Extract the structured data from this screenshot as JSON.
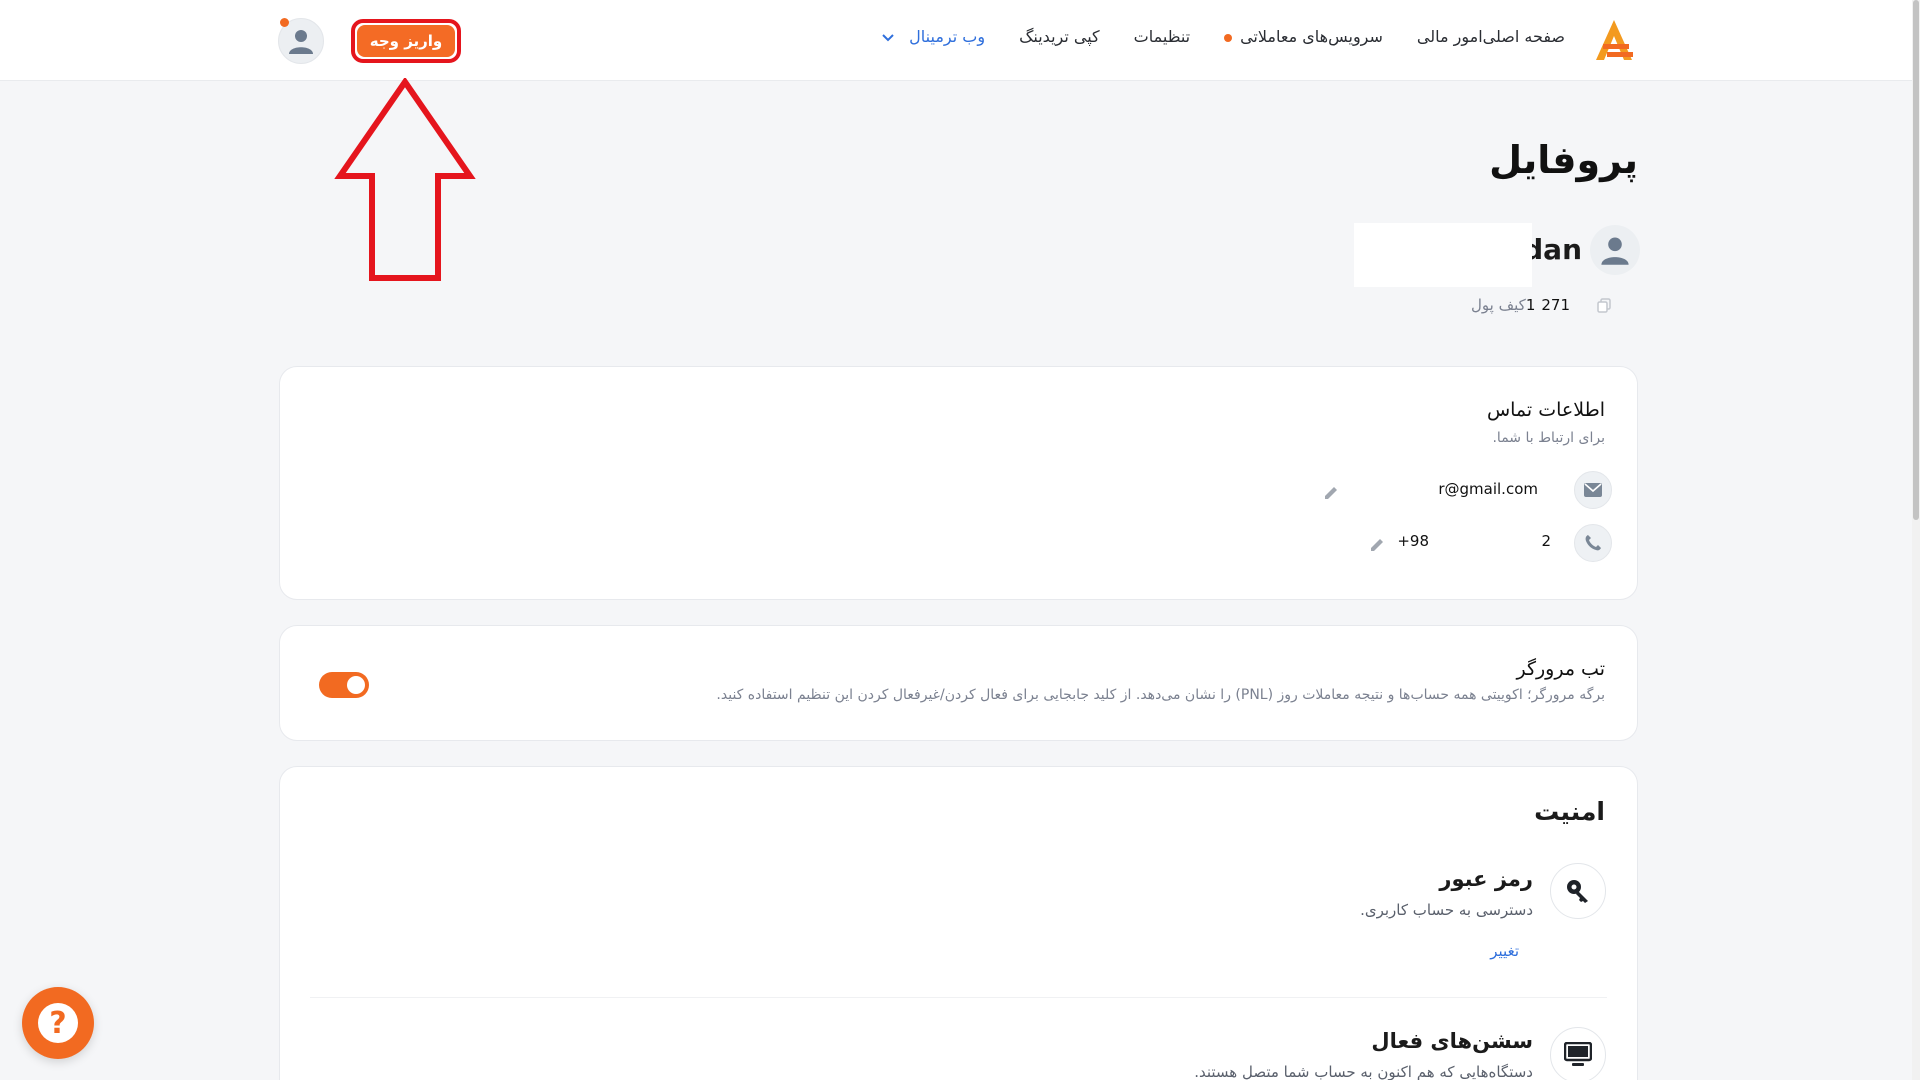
{
  "header": {
    "nav": [
      {
        "label": "صفحه اصلی",
        "dot": false
      },
      {
        "label": "امور مالی",
        "dot": false
      },
      {
        "label": "سرویس‌های معاملاتی",
        "dot": true
      },
      {
        "label": "تنظیمات",
        "dot": false
      },
      {
        "label": "کپی تریدینگ",
        "dot": false
      }
    ],
    "terminal_label": "وب ترمینال",
    "deposit_label": "واریز وجه"
  },
  "profile": {
    "title": "پروفایل",
    "name_partial": "idan",
    "wallet_label": "کیف پول",
    "wallet_value_1": "1",
    "wallet_value_2": "271"
  },
  "contact": {
    "title": "اطلاعات تماس",
    "subtitle": "برای ارتباط با شما.",
    "email": "r@gmail.com",
    "phone_prefix": "+98",
    "phone_tail": "2"
  },
  "browser_tab": {
    "title": "تب مرورگر",
    "description": "برگه مرورگر؛ اکوییتی همه حساب‌ها و نتیجه معاملات روز (PNL) را نشان می‌دهد. از کلید جابجایی برای فعال کردن/غیرفعال کردن این تنظیم استفاده کنید.",
    "enabled": true
  },
  "security": {
    "title": "امنیت",
    "password_title": "رمز عبور",
    "password_sub": "دسترسی به حساب کاربری.",
    "password_link": "تغییر",
    "sessions_title": "سشن‌های فعال",
    "sessions_sub": "دستگاه‌هایی که هم اکنون به حساب شما متصل هستند."
  },
  "colors": {
    "accent": "#f26a21",
    "annotation": "#e5151d",
    "link": "#2f6fdc"
  }
}
